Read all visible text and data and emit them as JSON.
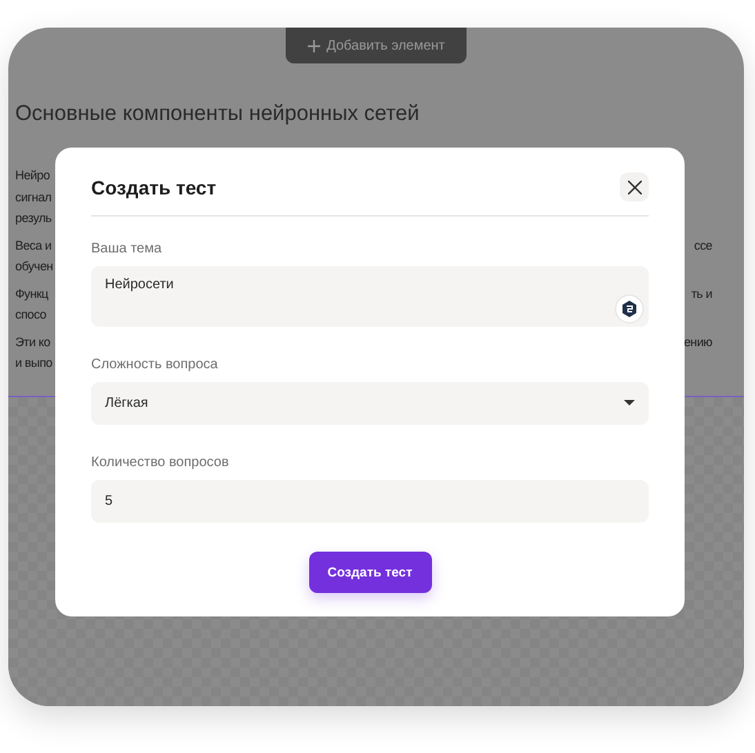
{
  "toolbar": {
    "add_button": "Добавить элемент"
  },
  "document": {
    "heading": "Основные компоненты нейронных сетей",
    "paragraphs": [
      {
        "lines": [
          {
            "left": "Нейро"
          },
          {
            "left": "сигнал"
          },
          {
            "left": "резуль"
          }
        ]
      },
      {
        "lines": [
          {
            "left": "Веса и",
            "right": "ссе"
          },
          {
            "left": "обучен"
          }
        ]
      },
      {
        "lines": [
          {
            "left": "Функц",
            "right": "ть и"
          },
          {
            "left": "спосо"
          }
        ]
      },
      {
        "lines": [
          {
            "left": "Эти ко",
            "right": "ению"
          },
          {
            "left": "и выпо"
          }
        ]
      }
    ]
  },
  "dialog": {
    "title": "Создать тест",
    "fields": [
      {
        "kind": "textarea",
        "label": "Ваша тема",
        "value": "Нейросети"
      },
      {
        "kind": "select",
        "label": "Сложность вопроса",
        "value": "Лёгкая"
      },
      {
        "kind": "input",
        "label": "Количество вопросов",
        "value": "5"
      }
    ],
    "submit": "Создать тест"
  }
}
